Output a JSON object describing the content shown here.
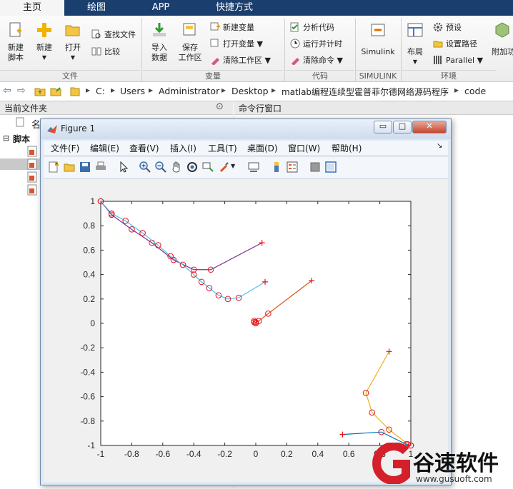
{
  "tabs": [
    "主页",
    "绘图",
    "APP",
    "快捷方式"
  ],
  "ribbon": {
    "new_script": "新建\n脚本",
    "new": "新建",
    "open": "打开",
    "find_files": "查找文件",
    "compare": "比较",
    "import_data": "导入\n数据",
    "save_workspace": "保存\n工作区",
    "new_variable": "新建变量",
    "open_variable": "打开变量",
    "clear_workspace": "清除工作区",
    "analyze_code": "分析代码",
    "run_and_time": "运行并计时",
    "clear_commands": "清除命令",
    "simulink": "Simulink",
    "layout": "布局",
    "preferences": "预设",
    "set_path": "设置路径",
    "parallel": "Parallel",
    "addons": "附加功",
    "groups": {
      "file": "文件",
      "variable": "变量",
      "code": "代码",
      "simulink": "SIMULINK",
      "environment": "环境"
    }
  },
  "address": [
    "C:",
    "Users",
    "Administrator",
    "Desktop",
    "matlab编程连续型霍普菲尔德网络源码程序",
    "code"
  ],
  "left_panel": {
    "title": "当前文件夹",
    "col_name": "名",
    "tree_root": "脚本"
  },
  "command_window": {
    "title": "命令行窗口"
  },
  "figure": {
    "title": "Figure 1",
    "menu": [
      "文件(F)",
      "编辑(E)",
      "查看(V)",
      "插入(I)",
      "工具(T)",
      "桌面(D)",
      "窗口(W)",
      "帮助(H)"
    ],
    "minimize": "▭",
    "maximize": "□",
    "close": "✕"
  },
  "chart_data": {
    "type": "line",
    "xlim": [
      -1,
      1
    ],
    "ylim": [
      -1,
      1
    ],
    "xticks": [
      "-1",
      "-0.8",
      "-0.6",
      "-0.4",
      "-0.2",
      "0",
      "0.2",
      "0.4",
      "0.6",
      "0.8",
      "1"
    ],
    "yticks": [
      "1",
      "0.8",
      "0.6",
      "0.4",
      "0.2",
      "0",
      "-0.2",
      "-0.4",
      "-0.6",
      "-0.8",
      "-1"
    ],
    "grid": false,
    "series": [
      {
        "color": "#7e2f8e",
        "points": [
          [
            0.04,
            0.66
          ],
          [
            -0.29,
            0.44
          ],
          [
            -0.4,
            0.44
          ],
          [
            -0.53,
            0.52
          ],
          [
            -0.67,
            0.66
          ],
          [
            -0.8,
            0.77
          ],
          [
            -0.93,
            0.89
          ],
          [
            -1,
            1
          ]
        ]
      },
      {
        "color": "#4dbeee",
        "points": [
          [
            0.06,
            0.34
          ],
          [
            -0.11,
            0.21
          ],
          [
            -0.18,
            0.2
          ],
          [
            -0.24,
            0.23
          ],
          [
            -0.3,
            0.29
          ],
          [
            -0.35,
            0.34
          ],
          [
            -0.4,
            0.4
          ],
          [
            -0.47,
            0.48
          ],
          [
            -0.55,
            0.55
          ],
          [
            -0.63,
            0.64
          ],
          [
            -0.73,
            0.74
          ],
          [
            -0.84,
            0.84
          ],
          [
            -0.93,
            0.9
          ],
          [
            -1,
            1
          ]
        ]
      },
      {
        "color": "#d95319",
        "points": [
          [
            0.36,
            0.35
          ],
          [
            0.08,
            0.08
          ],
          [
            0.02,
            0.02
          ],
          [
            0.0,
            0.01
          ],
          [
            -0.01,
            0.01
          ],
          [
            -0.01,
            0.02
          ],
          [
            0.0,
            0.0
          ]
        ]
      },
      {
        "color": "#edb120",
        "points": [
          [
            0.86,
            -0.23
          ],
          [
            0.71,
            -0.57
          ],
          [
            0.75,
            -0.73
          ],
          [
            0.86,
            -0.87
          ],
          [
            0.98,
            -0.99
          ],
          [
            1,
            -1
          ]
        ]
      },
      {
        "color": "#0072bd",
        "points": [
          [
            0.56,
            -0.91
          ],
          [
            0.81,
            -0.89
          ],
          [
            0.97,
            -0.99
          ],
          [
            1,
            -1
          ]
        ]
      }
    ]
  },
  "watermark": {
    "brand": "谷速软件",
    "url": "www.gusuoft.com"
  }
}
